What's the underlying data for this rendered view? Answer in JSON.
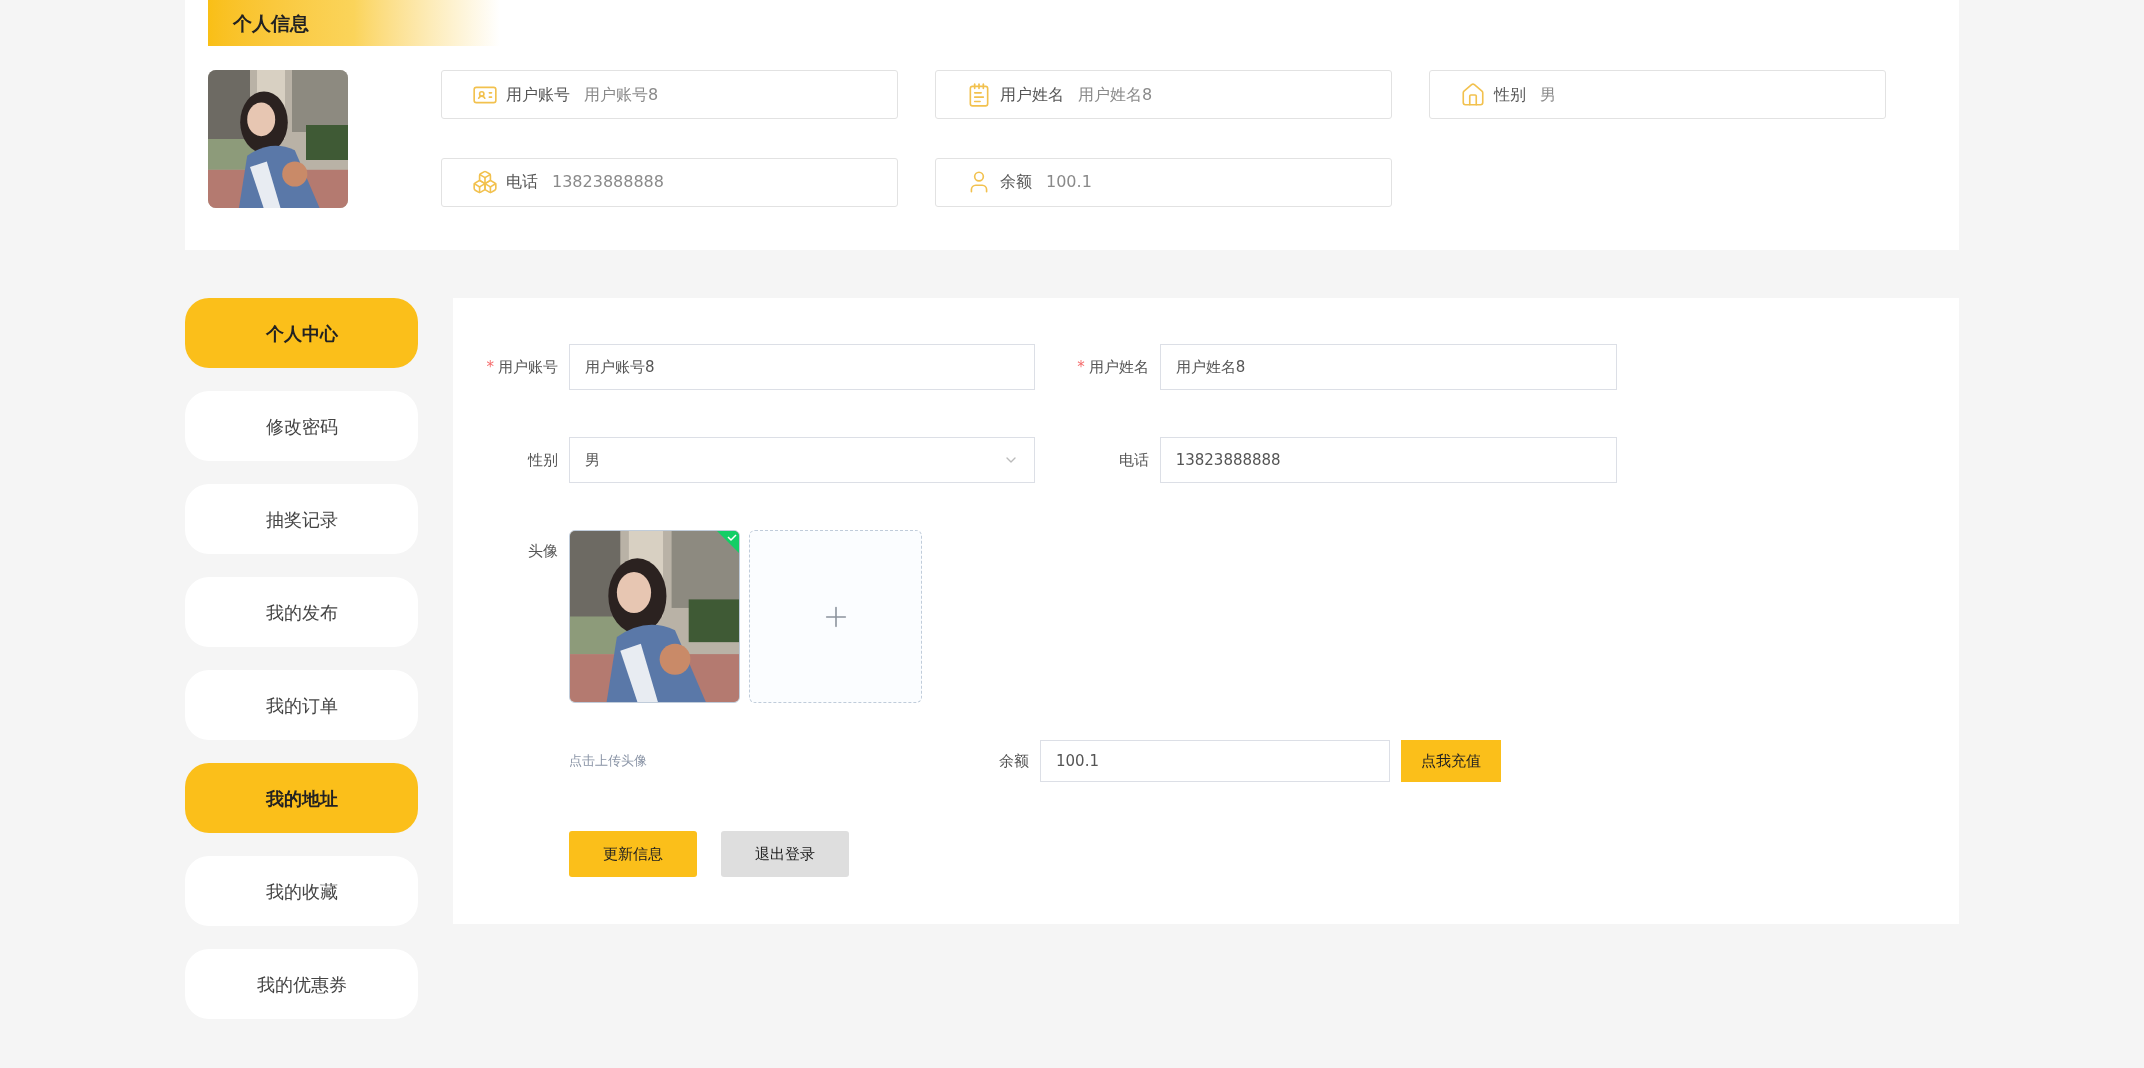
{
  "profile": {
    "title": "个人信息",
    "fields": [
      {
        "label": "用户账号",
        "value": "用户账号8"
      },
      {
        "label": "用户姓名",
        "value": "用户姓名8"
      },
      {
        "label": "性别",
        "value": "男"
      },
      {
        "label": "电话",
        "value": "13823888888"
      },
      {
        "label": "余额",
        "value": "100.1"
      }
    ]
  },
  "sidebar": {
    "items": [
      {
        "label": "个人中心",
        "selected": true
      },
      {
        "label": "修改密码",
        "selected": false
      },
      {
        "label": "抽奖记录",
        "selected": false
      },
      {
        "label": "我的发布",
        "selected": false
      },
      {
        "label": "我的订单",
        "selected": false
      },
      {
        "label": "我的地址",
        "selected": true
      },
      {
        "label": "我的收藏",
        "selected": false
      },
      {
        "label": "我的优惠券",
        "selected": false
      }
    ]
  },
  "form": {
    "fields": [
      {
        "kind": "text",
        "mark": "*",
        "label": "用户账号",
        "value": "用户账号8"
      },
      {
        "kind": "text",
        "mark": "*",
        "label": "用户姓名",
        "value": "用户姓名8"
      },
      {
        "kind": "select",
        "label": "性别",
        "value": "男"
      },
      {
        "kind": "text",
        "label": "电话",
        "value": "13823888888"
      }
    ],
    "avatar": {
      "label": "头像",
      "hint": "点击上传头像"
    },
    "balance": {
      "label": "余额",
      "value": "100.1",
      "button": "点我充值"
    },
    "buttons": [
      {
        "kind": "primary",
        "label": "更新信息"
      },
      {
        "kind": "secondary",
        "label": "退出登录"
      }
    ]
  }
}
